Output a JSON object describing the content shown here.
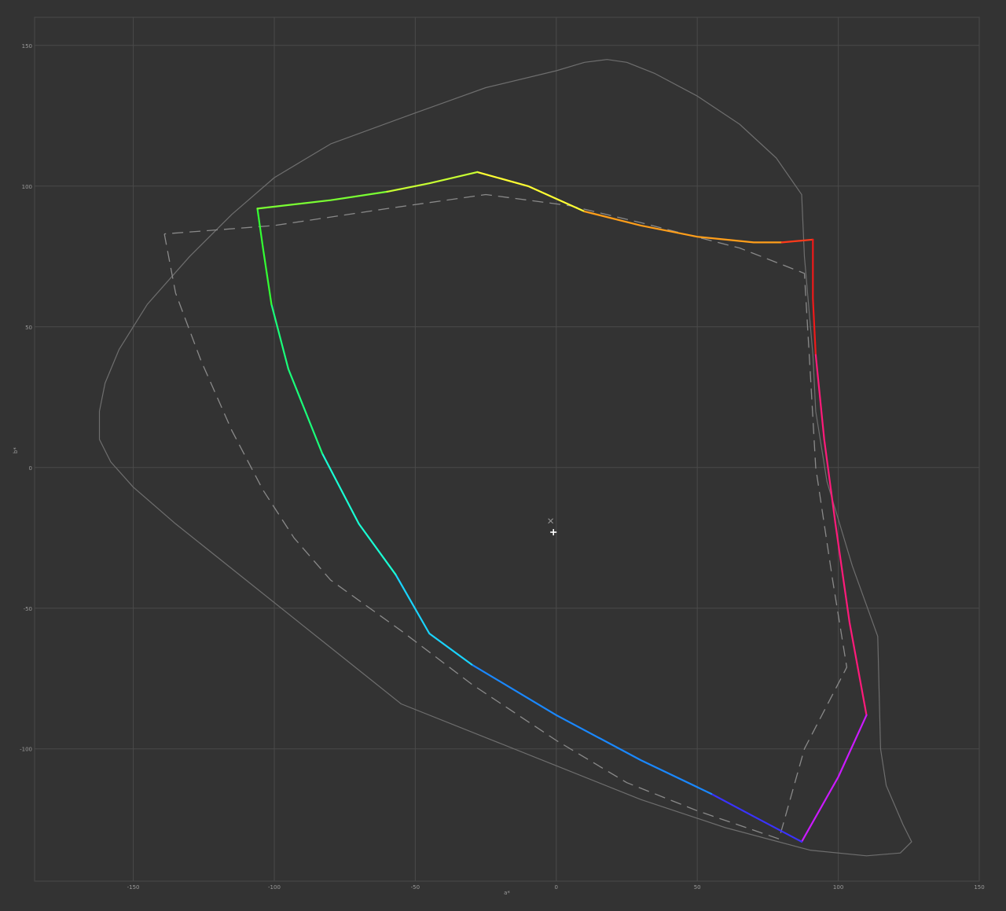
{
  "chart_data": {
    "type": "line",
    "title": "",
    "xlabel": "a*",
    "ylabel": "b*",
    "xlim": [
      -185,
      150
    ],
    "ylim": [
      -147,
      160
    ],
    "grid": true,
    "x_ticks": [
      "-150",
      "-100",
      "-50",
      "0",
      "50",
      "100",
      "150"
    ],
    "x_tick_values": [
      -150,
      -100,
      -50,
      0,
      50,
      100,
      150
    ],
    "y_ticks": [
      "150",
      "100",
      "50",
      "0",
      "-50",
      "-100"
    ],
    "y_tick_values": [
      150,
      100,
      50,
      0,
      -50,
      -100
    ],
    "colors": {
      "background": "#333333",
      "grid": "#4a4a4a",
      "spectral_locus": "#6e6e6e",
      "reference_gamut": "#8a8a8a",
      "marker": "#ffffff",
      "white_point": "#9a9a9a"
    },
    "spectral_locus": [
      [
        -162,
        20
      ],
      [
        -160,
        30
      ],
      [
        -155,
        42
      ],
      [
        -145,
        58
      ],
      [
        -130,
        75
      ],
      [
        -115,
        90
      ],
      [
        -100,
        103
      ],
      [
        -80,
        115
      ],
      [
        -50,
        126
      ],
      [
        -25,
        135
      ],
      [
        0,
        141
      ],
      [
        10,
        144
      ],
      [
        18,
        145
      ],
      [
        25,
        144
      ],
      [
        35,
        140
      ],
      [
        50,
        132
      ],
      [
        65,
        122
      ],
      [
        78,
        110
      ],
      [
        87,
        97
      ],
      [
        88,
        75
      ],
      [
        91,
        40
      ],
      [
        92,
        20
      ],
      [
        96,
        -5
      ],
      [
        105,
        -35
      ],
      [
        114,
        -60
      ],
      [
        115,
        -100
      ],
      [
        117,
        -113
      ],
      [
        123,
        -127
      ],
      [
        126,
        -133
      ],
      [
        122,
        -137
      ],
      [
        110,
        -138
      ],
      [
        90,
        -136
      ],
      [
        60,
        -128
      ],
      [
        30,
        -118
      ],
      [
        0,
        -106
      ],
      [
        -25,
        -96
      ],
      [
        -55,
        -84
      ],
      [
        -80,
        -64
      ],
      [
        -110,
        -40
      ],
      [
        -135,
        -20
      ],
      [
        -150,
        -7
      ],
      [
        -158,
        2
      ],
      [
        -162,
        10
      ],
      [
        -162,
        20
      ]
    ],
    "reference_gamut": [
      [
        -139,
        83
      ],
      [
        -135,
        62
      ],
      [
        -126,
        38
      ],
      [
        -115,
        13
      ],
      [
        -104,
        -8
      ],
      [
        -93,
        -25
      ],
      [
        -80,
        -40
      ],
      [
        -55,
        -58
      ],
      [
        -30,
        -77
      ],
      [
        0,
        -97
      ],
      [
        25,
        -112
      ],
      [
        50,
        -122
      ],
      [
        79,
        -132
      ],
      [
        88,
        -100
      ],
      [
        103,
        -71
      ],
      [
        98,
        -40
      ],
      [
        92,
        0
      ],
      [
        90,
        35
      ],
      [
        88,
        69
      ],
      [
        65,
        78
      ],
      [
        30,
        87
      ],
      [
        5,
        93
      ],
      [
        -25,
        97
      ],
      [
        -60,
        92
      ],
      [
        -100,
        86
      ],
      [
        -139,
        83
      ]
    ],
    "gamut_segments": [
      {
        "color": "#ffff33",
        "points": [
          [
            -28,
            105
          ],
          [
            -10,
            100
          ],
          [
            10,
            91
          ]
        ]
      },
      {
        "color": "#ff9e1a",
        "points": [
          [
            10,
            91
          ],
          [
            30,
            86
          ],
          [
            50,
            82
          ],
          [
            70,
            80
          ],
          [
            80,
            80
          ]
        ]
      },
      {
        "color": "#ff3a1a",
        "points": [
          [
            80,
            80
          ],
          [
            91,
            81
          ]
        ]
      },
      {
        "color": "#ee1a1a",
        "points": [
          [
            91,
            81
          ],
          [
            91,
            60
          ],
          [
            92,
            40
          ]
        ]
      },
      {
        "color": "#ff1a7a",
        "points": [
          [
            92,
            40
          ],
          [
            95,
            10
          ],
          [
            99,
            -20
          ],
          [
            104,
            -55
          ],
          [
            110,
            -88
          ]
        ]
      },
      {
        "color": "#cc1aff",
        "points": [
          [
            110,
            -88
          ],
          [
            100,
            -110
          ],
          [
            87,
            -133
          ]
        ]
      },
      {
        "color": "#3a33ff",
        "points": [
          [
            87,
            -133
          ],
          [
            70,
            -124
          ],
          [
            55,
            -116
          ]
        ]
      },
      {
        "color": "#1a88ff",
        "points": [
          [
            55,
            -116
          ],
          [
            30,
            -104
          ],
          [
            0,
            -88
          ],
          [
            -30,
            -70
          ]
        ]
      },
      {
        "color": "#1ad4ff",
        "points": [
          [
            -30,
            -70
          ],
          [
            -45,
            -59
          ],
          [
            -57,
            -38
          ]
        ]
      },
      {
        "color": "#1affd4",
        "points": [
          [
            -57,
            -38
          ],
          [
            -70,
            -20
          ],
          [
            -83,
            5
          ]
        ]
      },
      {
        "color": "#1aff7a",
        "points": [
          [
            -83,
            5
          ],
          [
            -95,
            35
          ],
          [
            -101,
            58
          ]
        ]
      },
      {
        "color": "#33ff33",
        "points": [
          [
            -101,
            58
          ],
          [
            -104,
            78
          ],
          [
            -106,
            92
          ]
        ]
      },
      {
        "color": "#7aff33",
        "points": [
          [
            -106,
            92
          ],
          [
            -80,
            95
          ],
          [
            -60,
            98
          ]
        ]
      },
      {
        "color": "#c8ff33",
        "points": [
          [
            -60,
            98
          ],
          [
            -45,
            101
          ],
          [
            -28,
            105
          ]
        ]
      }
    ],
    "white_point": [
      -2,
      -19
    ],
    "target_marker": [
      -1,
      -23
    ]
  }
}
